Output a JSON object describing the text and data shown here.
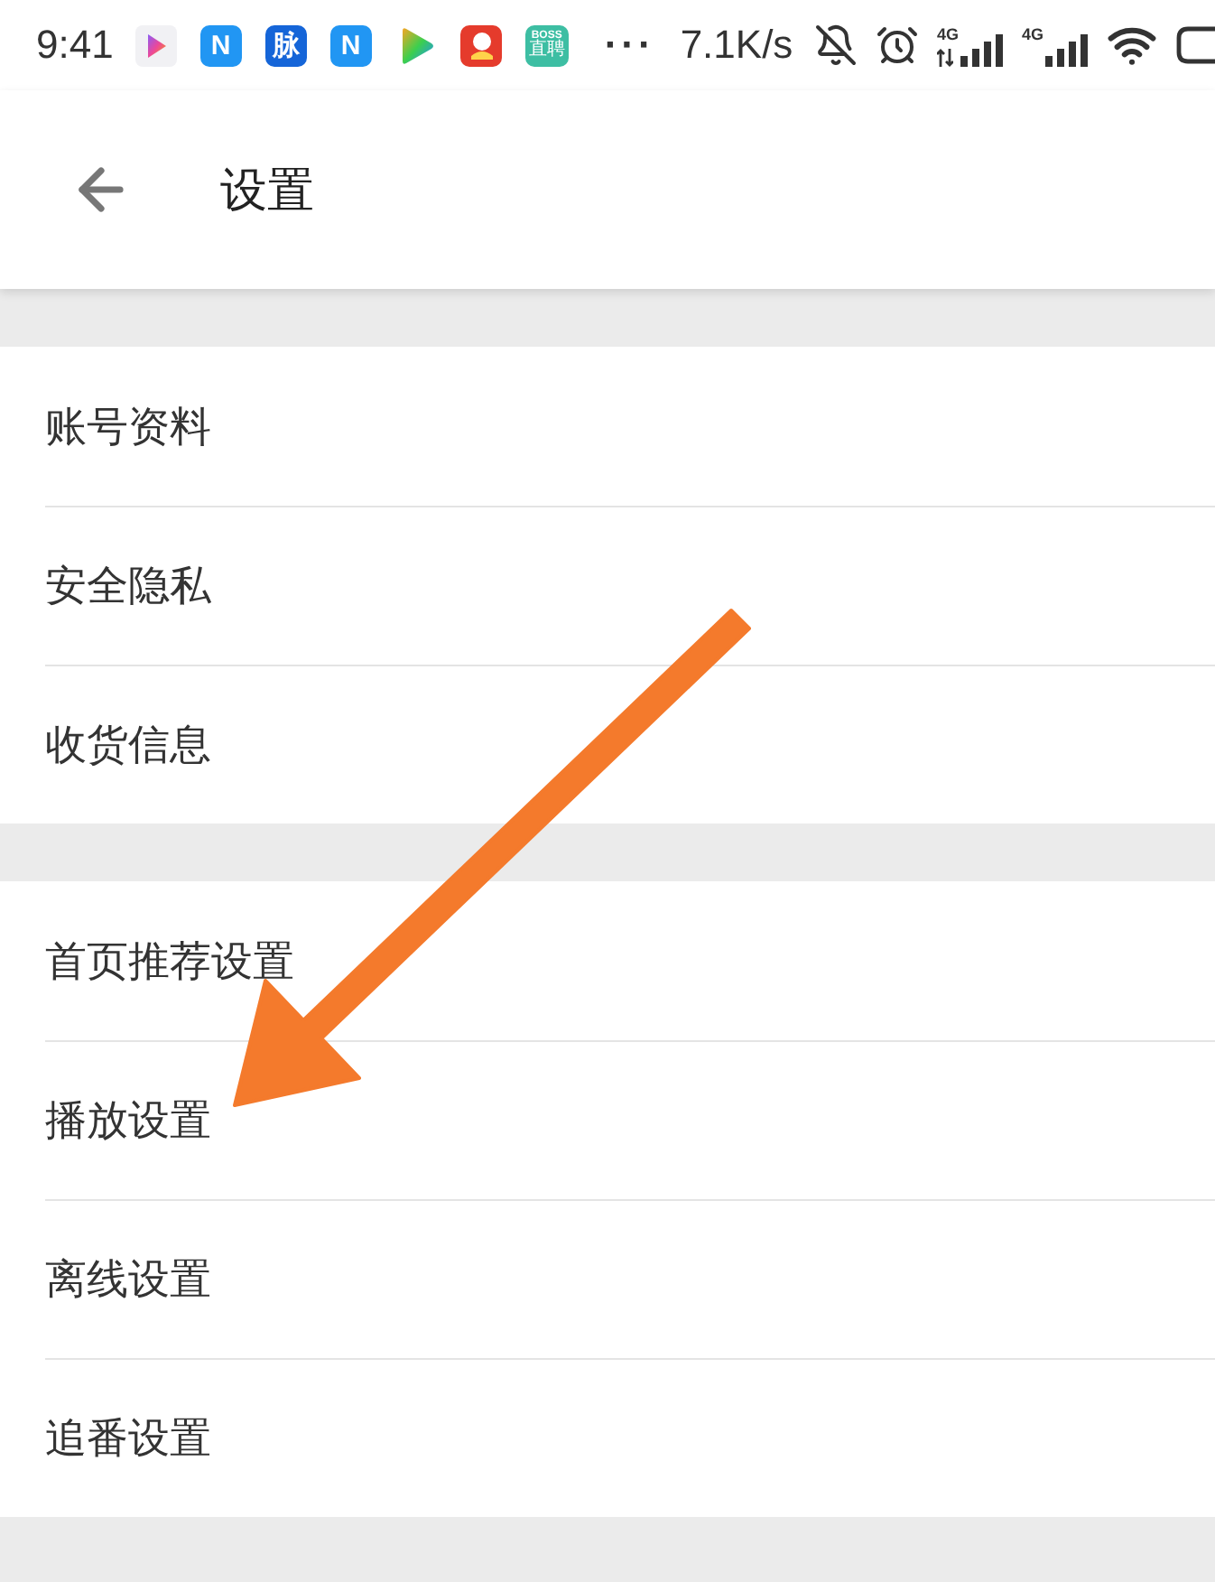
{
  "status_bar": {
    "time": "9:41",
    "notifications": [
      {
        "kind": "play"
      },
      {
        "kind": "letter",
        "label": "N",
        "color": "#2196f3"
      },
      {
        "kind": "letter",
        "label": "脉",
        "color": "#1565d8"
      },
      {
        "kind": "letter",
        "label": "N",
        "color": "#2196f3"
      },
      {
        "kind": "video"
      },
      {
        "kind": "mascot",
        "color": "#e53b2c"
      },
      {
        "kind": "badge",
        "lines": [
          "BOSS",
          "直聘"
        ],
        "color": "#3dbea3"
      }
    ],
    "more": "···",
    "speed": "7.1K/s",
    "indicators": [
      {
        "kind": "mute"
      },
      {
        "kind": "alarm"
      },
      {
        "kind": "signal",
        "label": "4G",
        "data_arrows": true
      },
      {
        "kind": "signal",
        "label": "4G",
        "data_arrows": false
      },
      {
        "kind": "wifi"
      },
      {
        "kind": "battery"
      }
    ]
  },
  "header": {
    "title": "设置"
  },
  "groups": [
    {
      "items": [
        {
          "label": "账号资料"
        },
        {
          "label": "安全隐私"
        },
        {
          "label": "收货信息"
        }
      ]
    },
    {
      "items": [
        {
          "label": "首页推荐设置"
        },
        {
          "label": "播放设置"
        },
        {
          "label": "离线设置"
        },
        {
          "label": "追番设置"
        }
      ]
    }
  ]
}
